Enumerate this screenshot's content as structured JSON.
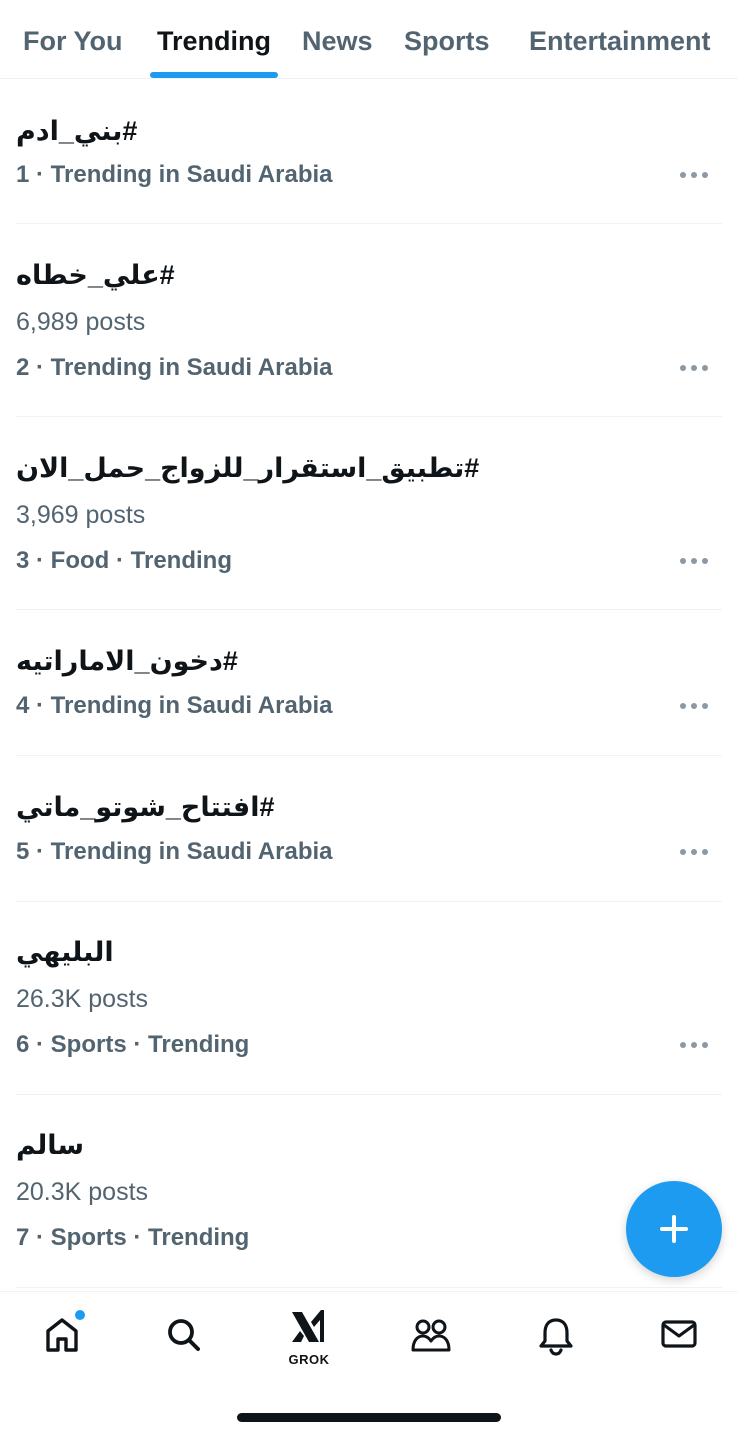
{
  "tabs": [
    {
      "label": "For You"
    },
    {
      "label": "Trending"
    },
    {
      "label": "News"
    },
    {
      "label": "Sports"
    },
    {
      "label": "Entertainment"
    }
  ],
  "active_tab": "Trending",
  "trends": [
    {
      "title": "#بني_ادم",
      "posts": "",
      "meta": "1 · Trending in Saudi Arabia"
    },
    {
      "title": "#علي_خطاه",
      "posts": "6,989 posts",
      "meta": "2 · Trending in Saudi Arabia"
    },
    {
      "title": "#تطبيق_استقرار_للزواج_حمل_الان",
      "posts": "3,969 posts",
      "meta": "3 · Food · Trending"
    },
    {
      "title": "#دخون_الاماراتيه",
      "posts": "",
      "meta": "4 · Trending in Saudi Arabia"
    },
    {
      "title": "#افتتاح_شوتو_ماتي",
      "posts": "",
      "meta": "5 · Trending in Saudi Arabia"
    },
    {
      "title": "البليهي",
      "posts": "26.3K posts",
      "meta": "6 · Sports · Trending"
    },
    {
      "title": "سالم",
      "posts": "20.3K posts",
      "meta": "7 · Sports · Trending"
    }
  ],
  "fab": {
    "icon": "plus-icon"
  },
  "bottom_nav": {
    "items": [
      {
        "icon": "home-icon",
        "has_notification_dot": true
      },
      {
        "icon": "search-icon"
      },
      {
        "icon": "grok-icon",
        "label": "GROK"
      },
      {
        "icon": "communities-icon"
      },
      {
        "icon": "bell-icon"
      },
      {
        "icon": "mail-icon"
      }
    ]
  },
  "colors": {
    "accent": "#1d9bf0",
    "text_primary": "#0f1419",
    "text_secondary": "#536471",
    "divider": "#eff3f4"
  }
}
